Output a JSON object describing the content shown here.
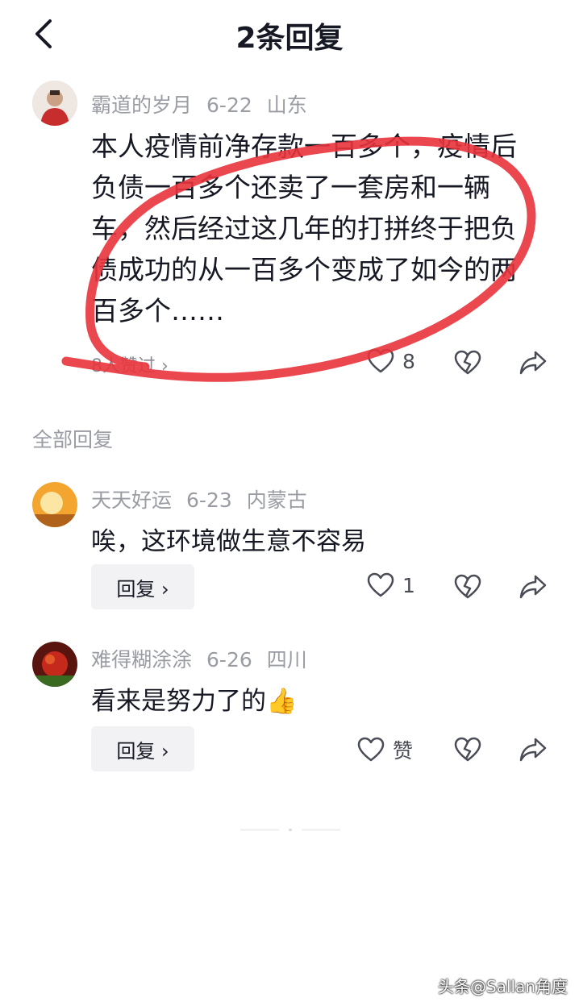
{
  "header": {
    "title": "2条回复"
  },
  "main_comment": {
    "username": "霸道的岁月",
    "date": "6-22",
    "location": "山东",
    "text": "本人疫情前净存款一百多个，疫情后负债一百多个还卖了一套房和一辆车，然后经过这几年的打拼终于把负债成功的从一百多个变成了如今的两百多个……",
    "likes_link": "8人赞过 ›",
    "like_count": "8"
  },
  "section": {
    "label": "全部回复"
  },
  "replies": [
    {
      "username": "天天好运",
      "date": "6-23",
      "location": "内蒙古",
      "text": "唉，这环境做生意不容易",
      "reply_label": "回复 ›",
      "like_count": "1"
    },
    {
      "username": "难得糊涂涂",
      "date": "6-26",
      "location": "四川",
      "text": "看来是努力了的👍",
      "reply_label": "回复 ›",
      "like_count": "赞"
    }
  ],
  "watermark": "头条@Sallan角度",
  "colors": {
    "annotation_red": "#e8333c",
    "meta_gray": "#9a9ca3"
  }
}
